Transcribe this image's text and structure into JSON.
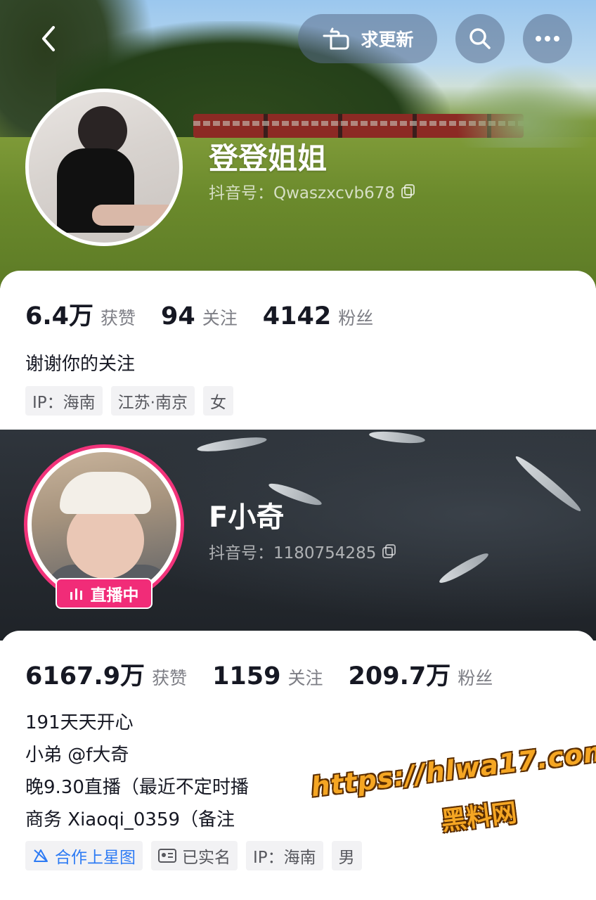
{
  "top_bar": {
    "request_update_label": "求更新"
  },
  "profile1": {
    "name": "登登姐姐",
    "douyin_id": "抖音号：Qwaszxcvb678",
    "stats": [
      {
        "value": "6.4万",
        "label": "获赞"
      },
      {
        "value": "94",
        "label": "关注"
      },
      {
        "value": "4142",
        "label": "粉丝"
      }
    ],
    "bio": [
      "谢谢你的关注"
    ],
    "tags": [
      "IP：海南",
      "江苏·南京",
      "女"
    ]
  },
  "profile2": {
    "name": "F小奇",
    "douyin_id": "抖音号：1180754285",
    "live_badge": "直播中",
    "stats": [
      {
        "value": "6167.9万",
        "label": "获赞"
      },
      {
        "value": "1159",
        "label": "关注"
      },
      {
        "value": "209.7万",
        "label": "粉丝"
      }
    ],
    "bio": [
      "191天天开心",
      "小弟 @f大奇",
      "晚9.30直播（最近不定时播",
      "商务 Xiaoqi_0359（备注"
    ],
    "tags": [
      "合作上星图",
      "已实名",
      "IP：海南",
      "男"
    ]
  },
  "watermark": {
    "url": "https://hlwa17.com",
    "site_name": "黑料网"
  },
  "colors": {
    "live_pink": "#f12c78",
    "star_blue": "#2d7bf4",
    "label_gray": "#7d7e85",
    "tag_bg": "#f2f2f4"
  }
}
